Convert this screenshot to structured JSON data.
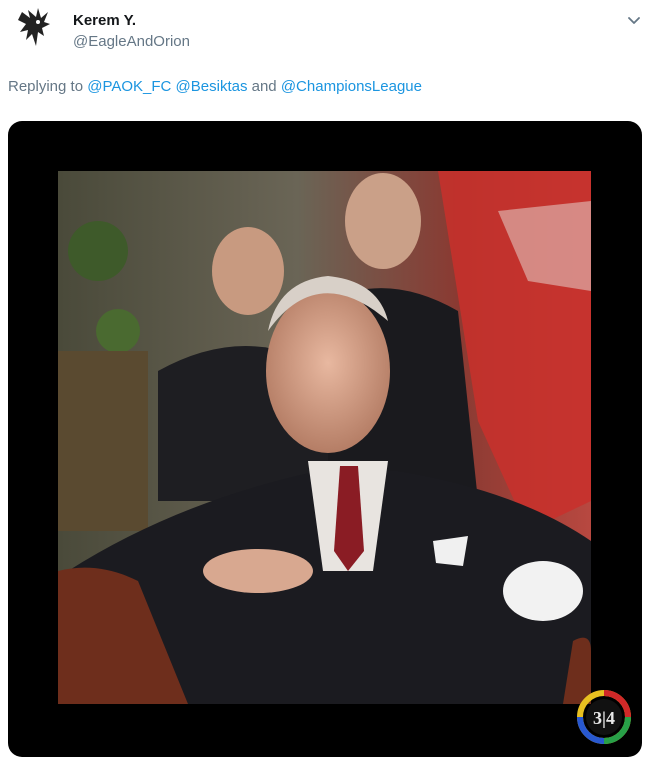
{
  "tweet": {
    "author_name": "Kerem Y.",
    "author_handle": "@EagleAndOrion",
    "avatar_icon": "eagle-emblem-icon",
    "menu_icon": "chevron-down-icon"
  },
  "reply": {
    "prefix": "Replying to ",
    "mentions": [
      "@PAOK_FC",
      "@Besiktas"
    ],
    "conjunction": " and ",
    "last_mention": "@ChampionsLeague"
  },
  "media": {
    "photo_description_icon": "portrait-photo",
    "watermark_text": "3|4",
    "colors": {
      "frame": "#000000",
      "link": "#1b95e0",
      "secondary_text": "#657786"
    }
  }
}
